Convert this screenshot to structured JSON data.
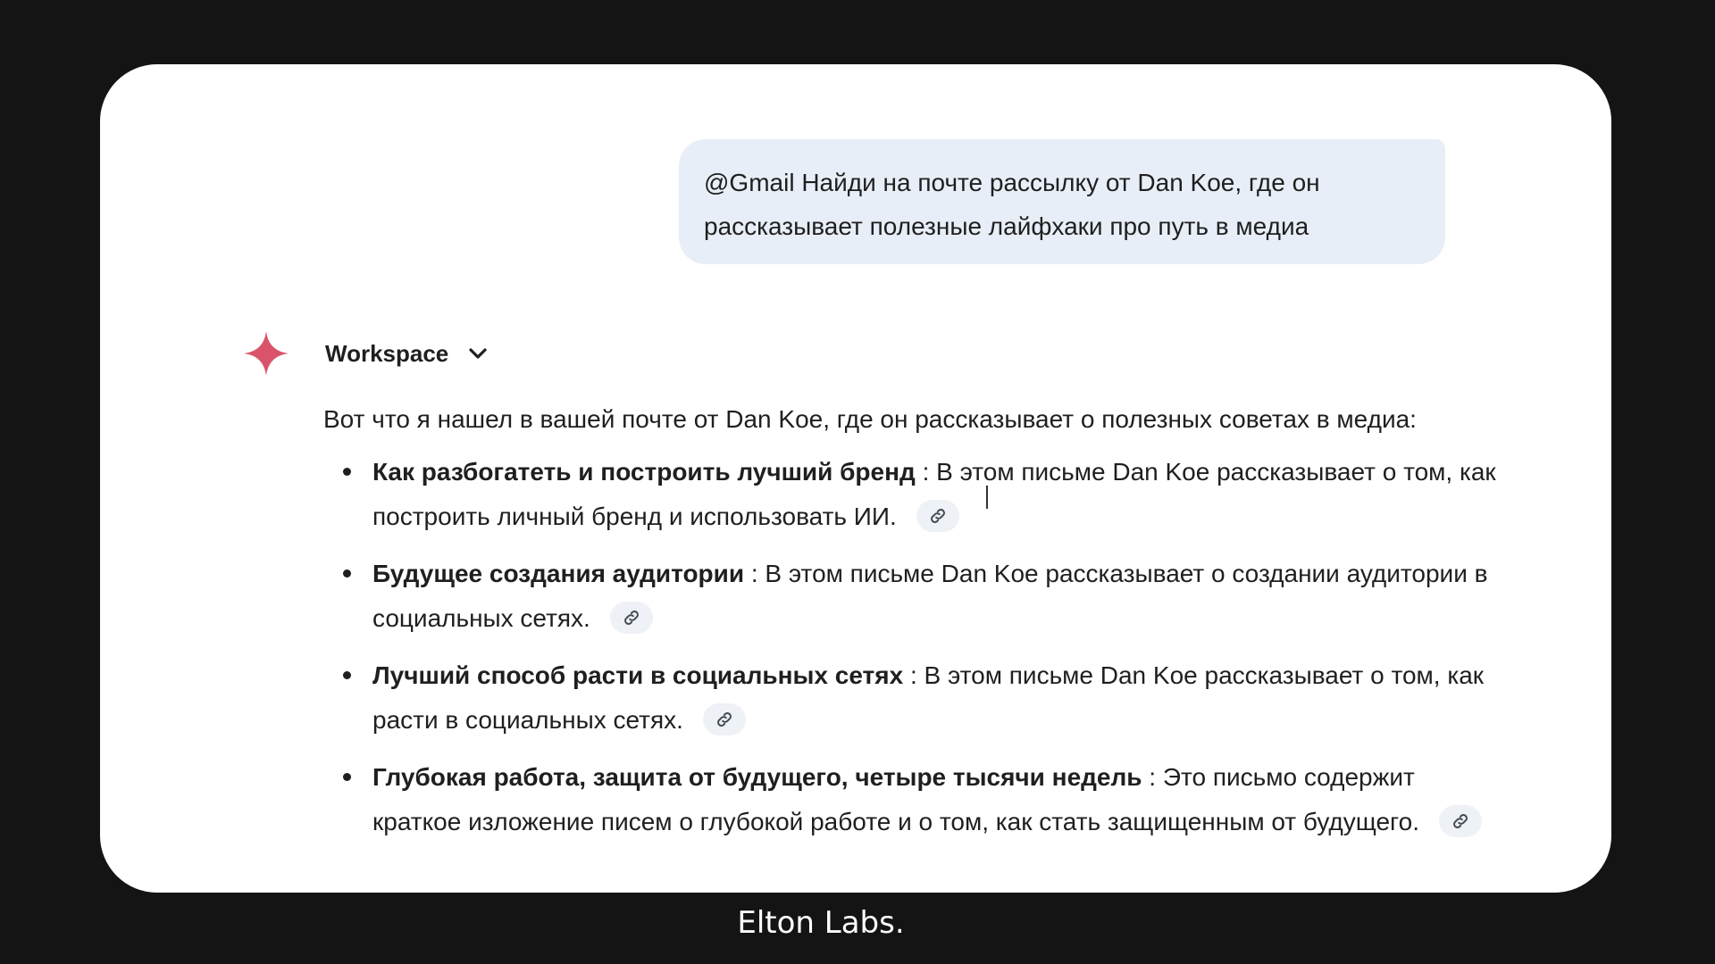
{
  "user_message": {
    "line1": "@Gmail Найди на почте рассылку от Dan Koe, где он",
    "line2": "рассказывает полезные лайфхаки про путь в медиа"
  },
  "assistant": {
    "icon": "gemini-sparkle-icon",
    "source_label": "Workspace",
    "dropdown_icon": "chevron-down-icon",
    "intro": "Вот что я нашел в вашей почте от Dan Koe, где он рассказывает о полезных советах в медиа:",
    "results": [
      {
        "title": "Как разбогатеть и построить лучший бренд",
        "description": " : В этом письме Dan Koe рассказывает о том, как построить личный бренд и использовать ИИ."
      },
      {
        "title": "Будущее создания аудитории",
        "description": " : В этом письме Dan Koe рассказывает о создании аудитории в социальных сетях."
      },
      {
        "title": "Лучший способ расти в социальных сетях",
        "description": " : В этом письме Dan Koe рассказывает о том, как расти в социальных сетях."
      },
      {
        "title": "Глубокая работа, защита от будущего, четыре тысячи недель",
        "description": " : Это письмо содержит краткое изложение писем о глубокой работе и о том, как стать защищенным от будущего."
      }
    ],
    "link_icon": "link-icon"
  },
  "footer": {
    "brand": "Elton Labs."
  },
  "colors": {
    "background": "#141414",
    "card": "#ffffff",
    "user_bubble": "#e8eef7",
    "sparkle": "#d9546a",
    "text": "#1f1f1f"
  }
}
